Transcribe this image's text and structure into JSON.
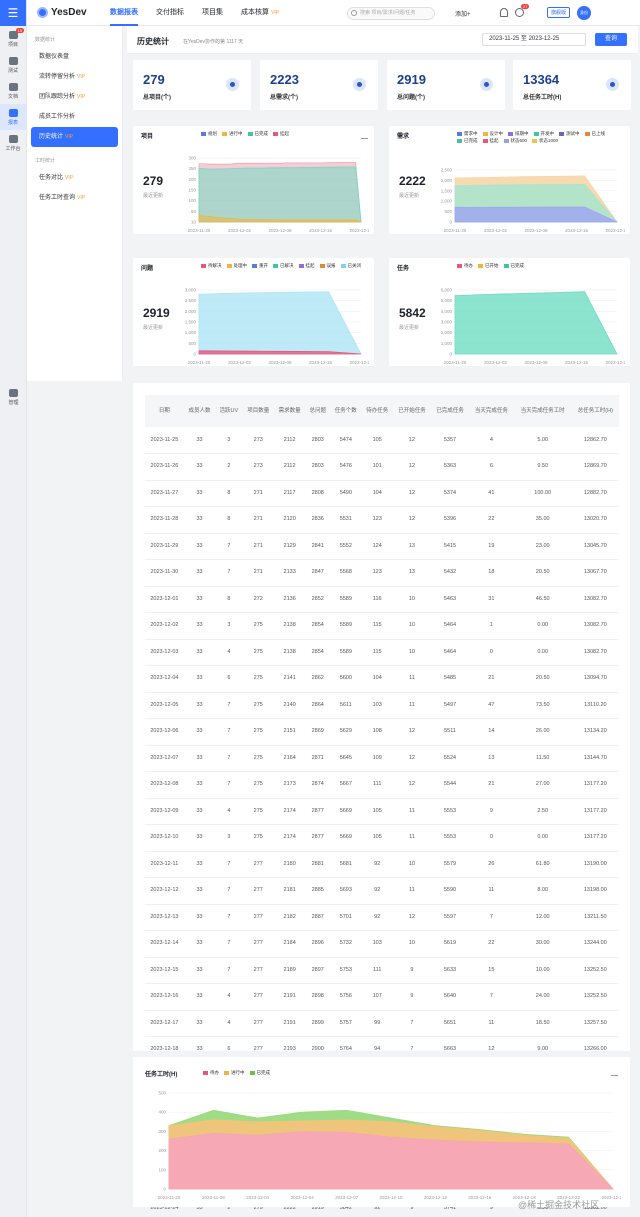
{
  "topbar": {
    "logo": "YesDev",
    "nav": [
      {
        "label": "数据报表",
        "active": true,
        "vip": ""
      },
      {
        "label": "交付指标",
        "active": false,
        "vip": ""
      },
      {
        "label": "项目集",
        "active": false,
        "vip": ""
      },
      {
        "label": "成本核算",
        "active": false,
        "vip": "VIP"
      }
    ],
    "search_placeholder": "搜索 项目/需求/问题/任务",
    "add_label": "添加+",
    "notif_badge": "27",
    "team_tag": "旗舰版",
    "avatar": "身份"
  },
  "rail": {
    "items": [
      {
        "label": "项目",
        "badge": "15"
      },
      {
        "label": "测试",
        "badge": ""
      },
      {
        "label": "文档",
        "badge": ""
      },
      {
        "label": "报表",
        "badge": ""
      },
      {
        "label": "工作台",
        "badge": ""
      }
    ],
    "manage": "管理"
  },
  "sidebar": {
    "group1": "数据统计",
    "items1": [
      {
        "label": "数据仪表盘",
        "vip": ""
      },
      {
        "label": "流转停留分析",
        "vip": "VIP"
      },
      {
        "label": "团队跟踪分析",
        "vip": "VIP"
      },
      {
        "label": "成员工作分析",
        "vip": ""
      },
      {
        "label": "历史统计",
        "vip": "VIP"
      }
    ],
    "group2": "工时统计",
    "items2": [
      {
        "label": "任务对比",
        "vip": "VIP"
      },
      {
        "label": "任务工时查询",
        "vip": "VIP"
      }
    ]
  },
  "header": {
    "title": "历史统计",
    "subtitle": "在YesDev协作的第 1117 天",
    "date_range": "2023-11-25 至 2023-12-25",
    "query": "查询"
  },
  "stats": [
    {
      "value": "279",
      "label": "总项目(个)"
    },
    {
      "value": "2223",
      "label": "总需求(个)"
    },
    {
      "value": "2919",
      "label": "总问题(个)"
    },
    {
      "value": "13364",
      "label": "总任务工时(H)"
    }
  ],
  "charts": {
    "project": {
      "title": "项目",
      "big": "279",
      "sub": "最近更新",
      "legend": [
        {
          "n": "规划",
          "c": "#5b7bd5"
        },
        {
          "n": "进行中",
          "c": "#f0b440"
        },
        {
          "n": "已完成",
          "c": "#43c4a3"
        },
        {
          "n": "挂起",
          "c": "#e8577a"
        }
      ],
      "ylabels": [
        "300",
        "250",
        "200",
        "150",
        "100",
        "50",
        "10"
      ],
      "xlabels": [
        "2023-11-25",
        "2023-12-02",
        "2023-12-09",
        "2023-12-16",
        "2023-12-23"
      ]
    },
    "demand": {
      "title": "需求",
      "big": "2222",
      "sub": "最近更新",
      "legend": [
        {
          "n": "需求中",
          "c": "#5b7bd5"
        },
        {
          "n": "设计中",
          "c": "#f0b440"
        },
        {
          "n": "排期中",
          "c": "#8e6fd8"
        },
        {
          "n": "开发中",
          "c": "#43c4a3"
        },
        {
          "n": "测试中",
          "c": "#5d6bb5"
        },
        {
          "n": "已上线",
          "c": "#e08a3c"
        },
        {
          "n": "已完成",
          "c": "#4cc08e"
        },
        {
          "n": "挂起",
          "c": "#e8577a"
        },
        {
          "n": "状态600",
          "c": "#9aa3d6"
        },
        {
          "n": "状态1000",
          "c": "#f2c14e"
        }
      ],
      "ylabels": [
        "2,500",
        "2,000",
        "1,500",
        "1,000",
        "500",
        "0"
      ],
      "xlabels": [
        "2023-11-25",
        "2023-12-02",
        "2023-12-09",
        "2023-12-16",
        "2023-12-23"
      ]
    },
    "issue": {
      "title": "问题",
      "big": "2919",
      "sub": "最近更新",
      "legend": [
        {
          "n": "待解决",
          "c": "#e8577a"
        },
        {
          "n": "处理中",
          "c": "#f0b440"
        },
        {
          "n": "重开",
          "c": "#5b7bd5"
        },
        {
          "n": "已解决",
          "c": "#43c4a3"
        },
        {
          "n": "挂起",
          "c": "#8e6fd8"
        },
        {
          "n": "误报",
          "c": "#e08a3c"
        },
        {
          "n": "已关闭",
          "c": "#7dd3ee"
        }
      ],
      "ylabels": [
        "3,000",
        "2,500",
        "2,000",
        "1,500",
        "1,000",
        "500",
        "0"
      ],
      "xlabels": [
        "2023-11-25",
        "2023-12-02",
        "2023-12-09",
        "2023-12-16",
        "2023-12-23"
      ]
    },
    "task": {
      "title": "任务",
      "big": "5842",
      "sub": "最近更新",
      "legend": [
        {
          "n": "待办",
          "c": "#e8577a"
        },
        {
          "n": "已开始",
          "c": "#f0b440"
        },
        {
          "n": "已完成",
          "c": "#43c4a3"
        }
      ],
      "ylabels": [
        "6,000",
        "5,000",
        "4,000",
        "3,000",
        "2,000",
        "1,000",
        "0"
      ],
      "xlabels": [
        "2023-11-25",
        "2023-12-02",
        "2023-12-09",
        "2023-12-16",
        "2023-12-23"
      ]
    }
  },
  "chart_data": [
    {
      "type": "area",
      "title": "项目",
      "x": [
        "2023-11-25",
        "2023-11-26",
        "2023-11-27",
        "2023-11-28",
        "2023-11-29",
        "2023-11-30",
        "2023-12-01",
        "2023-12-02",
        "2023-12-03",
        "2023-12-04",
        "2023-12-05",
        "2023-12-06",
        "2023-12-07",
        "2023-12-08",
        "2023-12-09",
        "2023-12-10",
        "2023-12-11",
        "2023-12-12",
        "2023-12-13",
        "2023-12-14",
        "2023-12-15",
        "2023-12-16",
        "2023-12-17",
        "2023-12-18",
        "2023-12-19",
        "2023-12-20",
        "2023-12-21",
        "2023-12-22",
        "2023-12-23",
        "2023-12-24",
        "2023-12-25"
      ],
      "series": [
        {
          "name": "挂起",
          "values": [
            273,
            273,
            271,
            271,
            271,
            271,
            272,
            275,
            275,
            275,
            275,
            275,
            275,
            275,
            275,
            275,
            277,
            277,
            277,
            277,
            277,
            277,
            277,
            277,
            278,
            278,
            279,
            279,
            279,
            279,
            0
          ]
        },
        {
          "name": "已完成",
          "values": [
            250,
            250,
            248,
            248,
            249,
            249,
            250,
            252,
            252,
            253,
            253,
            253,
            253,
            254,
            254,
            254,
            255,
            255,
            255,
            256,
            256,
            256,
            256,
            257,
            257,
            257,
            258,
            258,
            258,
            258,
            0
          ]
        },
        {
          "name": "进行中",
          "values": [
            30,
            28,
            26,
            22,
            20,
            18,
            16,
            14,
            12,
            12,
            11,
            11,
            10,
            10,
            10,
            10,
            9,
            9,
            9,
            9,
            9,
            9,
            9,
            9,
            9,
            9,
            9,
            9,
            9,
            9,
            0
          ]
        }
      ],
      "ylim": [
        0,
        300
      ]
    },
    {
      "type": "area",
      "title": "需求",
      "x": [
        "2023-11-25",
        "2023-12-02",
        "2023-12-09",
        "2023-12-16",
        "2023-12-23",
        "2023-12-25"
      ],
      "series": [
        {
          "name": "已完成",
          "values": [
            2112,
            2138,
            2174,
            2191,
            2216,
            0
          ]
        },
        {
          "name": "开发中",
          "values": [
            1750,
            1770,
            1790,
            1800,
            1810,
            0
          ]
        },
        {
          "name": "需求中",
          "values": [
            700,
            705,
            712,
            718,
            722,
            0
          ]
        }
      ],
      "ylim": [
        0,
        2500
      ]
    },
    {
      "type": "area",
      "title": "问题",
      "x": [
        "2023-11-25",
        "2023-12-02",
        "2023-12-09",
        "2023-12-16",
        "2023-12-23",
        "2023-12-25"
      ],
      "series": [
        {
          "name": "已关闭",
          "values": [
            2803,
            2854,
            2877,
            2898,
            2919,
            0
          ]
        },
        {
          "name": "待解决",
          "values": [
            150,
            140,
            130,
            120,
            110,
            0
          ]
        }
      ],
      "ylim": [
        0,
        3000
      ]
    },
    {
      "type": "area",
      "title": "任务",
      "x": [
        "2023-11-25",
        "2023-12-02",
        "2023-12-09",
        "2023-12-16",
        "2023-12-23",
        "2023-12-25"
      ],
      "series": [
        {
          "name": "已完成",
          "values": [
            5474,
            5589,
            5669,
            5756,
            5841,
            0
          ]
        }
      ],
      "ylim": [
        0,
        6000
      ]
    },
    {
      "type": "area",
      "title": "任务工时(H)",
      "x": [
        "2023-11-25",
        "2023-11-28",
        "2023-12-01",
        "2023-12-04",
        "2023-12-07",
        "2023-12-10",
        "2023-12-13",
        "2023-12-16",
        "2023-12-19",
        "2023-12-22",
        "2023-12-25"
      ],
      "series": [
        {
          "name": "已完成",
          "values": [
            330,
            410,
            370,
            400,
            410,
            370,
            330,
            310,
            285,
            270,
            0
          ]
        },
        {
          "name": "进行中",
          "values": [
            330,
            360,
            350,
            355,
            360,
            350,
            325,
            305,
            280,
            265,
            0
          ]
        },
        {
          "name": "待办",
          "values": [
            260,
            290,
            280,
            300,
            295,
            270,
            255,
            245,
            240,
            235,
            0
          ]
        }
      ],
      "ylim": [
        0,
        500
      ]
    }
  ],
  "hours": {
    "title": "任务工时(H)",
    "legend": [
      {
        "n": "待办",
        "c": "#e8577a"
      },
      {
        "n": "进行中",
        "c": "#f0b440"
      },
      {
        "n": "已完成",
        "c": "#6cc04a"
      }
    ],
    "ylabels": [
      "500",
      "400",
      "300",
      "200",
      "100",
      "0"
    ],
    "xlabels": [
      "2023-11-25",
      "2023-11-28",
      "2023-12-01",
      "2023-12-04",
      "2023-12-07",
      "2023-12-10",
      "2023-12-13",
      "2023-12-16",
      "2023-12-19",
      "2023-12-22",
      "2023-12-25"
    ]
  },
  "table": {
    "headers": [
      "日期",
      "成员人数",
      "活跃UV",
      "项目数量",
      "需求数量",
      "总问题",
      "任务个数",
      "待办任务",
      "已开始任务",
      "已完成任务",
      "当天完成任务",
      "当天完成任务工时",
      "总任务工时(H)"
    ],
    "rows": [
      [
        "2023-11-25",
        "33",
        "3",
        "273",
        "2112",
        "2803",
        "5474",
        "105",
        "12",
        "5357",
        "4",
        "5.00",
        "12862.70"
      ],
      [
        "2023-11-26",
        "33",
        "2",
        "273",
        "2112",
        "2803",
        "5476",
        "101",
        "12",
        "5363",
        "6",
        "9.50",
        "12869.70"
      ],
      [
        "2023-11-27",
        "33",
        "8",
        "271",
        "2117",
        "2808",
        "5490",
        "104",
        "12",
        "5374",
        "41",
        "100.00",
        "12882.70"
      ],
      [
        "2023-11-28",
        "33",
        "8",
        "271",
        "2120",
        "2836",
        "5531",
        "123",
        "12",
        "5396",
        "22",
        "35.00",
        "13020.70"
      ],
      [
        "2023-11-29",
        "33",
        "7",
        "271",
        "2129",
        "2841",
        "5552",
        "124",
        "13",
        "5415",
        "19",
        "23.00",
        "13045.70"
      ],
      [
        "2023-11-30",
        "33",
        "7",
        "271",
        "2133",
        "2847",
        "5568",
        "123",
        "13",
        "5432",
        "18",
        "20.50",
        "13067.70"
      ],
      [
        "2023-12-01",
        "33",
        "8",
        "272",
        "2136",
        "2852",
        "5589",
        "116",
        "10",
        "5463",
        "31",
        "46.50",
        "13082.70"
      ],
      [
        "2023-12-02",
        "33",
        "3",
        "275",
        "2138",
        "2854",
        "5589",
        "115",
        "10",
        "5464",
        "1",
        "0.00",
        "13082.70"
      ],
      [
        "2023-12-03",
        "33",
        "4",
        "275",
        "2138",
        "2854",
        "5589",
        "115",
        "10",
        "5464",
        "0",
        "0.00",
        "13082.70"
      ],
      [
        "2023-12-04",
        "33",
        "6",
        "275",
        "2141",
        "2862",
        "5600",
        "104",
        "11",
        "5485",
        "21",
        "20.50",
        "13094.70"
      ],
      [
        "2023-12-05",
        "33",
        "7",
        "275",
        "2149",
        "2864",
        "5611",
        "103",
        "11",
        "5497",
        "47",
        "73.50",
        "13110.20"
      ],
      [
        "2023-12-06",
        "33",
        "7",
        "275",
        "2151",
        "2869",
        "5629",
        "108",
        "12",
        "5511",
        "14",
        "26.00",
        "13134.20"
      ],
      [
        "2023-12-07",
        "33",
        "7",
        "275",
        "2164",
        "2871",
        "5645",
        "109",
        "12",
        "5524",
        "13",
        "11.50",
        "13144.70"
      ],
      [
        "2023-12-08",
        "33",
        "7",
        "275",
        "2173",
        "2874",
        "5667",
        "111",
        "12",
        "5544",
        "21",
        "27.00",
        "13177.20"
      ],
      [
        "2023-12-09",
        "33",
        "4",
        "275",
        "2174",
        "2877",
        "5669",
        "105",
        "11",
        "5553",
        "9",
        "2.50",
        "13177.20"
      ],
      [
        "2023-12-10",
        "33",
        "3",
        "275",
        "2174",
        "2877",
        "5669",
        "105",
        "11",
        "5553",
        "0",
        "0.00",
        "13177.20"
      ],
      [
        "2023-12-11",
        "33",
        "7",
        "277",
        "2180",
        "2881",
        "5681",
        "92",
        "10",
        "5579",
        "26",
        "61.80",
        "13190.00"
      ],
      [
        "2023-12-12",
        "33",
        "7",
        "277",
        "2181",
        "2885",
        "5693",
        "92",
        "11",
        "5590",
        "11",
        "8.00",
        "13198.00"
      ],
      [
        "2023-12-13",
        "33",
        "7",
        "277",
        "2182",
        "2887",
        "5701",
        "92",
        "12",
        "5597",
        "7",
        "12.00",
        "13211.50"
      ],
      [
        "2023-12-14",
        "33",
        "7",
        "277",
        "2184",
        "2896",
        "5732",
        "103",
        "10",
        "5619",
        "22",
        "30.00",
        "13244.00"
      ],
      [
        "2023-12-15",
        "33",
        "7",
        "277",
        "2189",
        "2897",
        "5753",
        "111",
        "9",
        "5633",
        "15",
        "10.00",
        "13252.50"
      ],
      [
        "2023-12-16",
        "33",
        "4",
        "277",
        "2191",
        "2898",
        "5756",
        "107",
        "9",
        "5640",
        "7",
        "24.00",
        "13252.50"
      ],
      [
        "2023-12-17",
        "33",
        "4",
        "277",
        "2191",
        "2899",
        "5757",
        "99",
        "7",
        "5651",
        "11",
        "18.50",
        "13257.50"
      ],
      [
        "2023-12-18",
        "33",
        "6",
        "277",
        "2193",
        "2900",
        "5764",
        "94",
        "7",
        "5663",
        "12",
        "9.00",
        "13266.00"
      ],
      [
        "2023-12-19",
        "33",
        "7",
        "278",
        "2195",
        "2906",
        "5786",
        "95",
        "16",
        "5675",
        "12",
        "6.00",
        "13307.00"
      ],
      [
        "2023-12-20",
        "33",
        "8",
        "278",
        "2198",
        "2909",
        "5816",
        "102",
        "17",
        "5697",
        "22",
        "13.50",
        "13318.50"
      ],
      [
        "2023-12-21",
        "33",
        "7",
        "279",
        "2210",
        "2916",
        "5833",
        "96",
        "11",
        "5716",
        "25",
        "56.50",
        "13333.00"
      ],
      [
        "2023-12-22",
        "33",
        "7",
        "279",
        "2216",
        "2919",
        "5837",
        "98",
        "12",
        "5727",
        "14",
        "26.00",
        "13357.50"
      ],
      [
        "2023-12-23",
        "33",
        "4",
        "279",
        "2222",
        "2919",
        "5841",
        "98",
        "10",
        "5733",
        "10",
        "24.00",
        "13357.50"
      ],
      [
        "2023-12-24",
        "33",
        "2",
        "279",
        "2222",
        "2919",
        "5842",
        "92",
        "9",
        "5741",
        "9",
        "6.50",
        "13362.00"
      ]
    ]
  },
  "watermark": "@稀土掘金技术社区"
}
